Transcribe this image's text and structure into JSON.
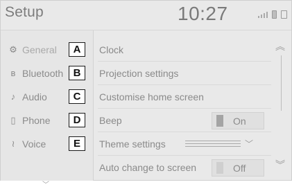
{
  "header": {
    "title": "Setup",
    "time": "10:27",
    "status_icons": [
      "signal-icon",
      "battery-icon",
      "phone-status-icon"
    ]
  },
  "sidebar": {
    "items": [
      {
        "label": "General",
        "icon": "gear-icon",
        "letter": "A",
        "active": true
      },
      {
        "label": "Bluetooth",
        "icon": "bluetooth-icon",
        "letter": "B"
      },
      {
        "label": "Audio",
        "icon": "music-note-icon",
        "letter": "C"
      },
      {
        "label": "Phone",
        "icon": "phone-icon",
        "letter": "D"
      },
      {
        "label": "Voice",
        "icon": "voice-icon",
        "letter": "E"
      }
    ],
    "more_icon": "chevron-down-icon"
  },
  "main": {
    "rows": [
      {
        "label": "Clock"
      },
      {
        "label": "Projection settings"
      },
      {
        "label": "Customise home screen"
      },
      {
        "label": "Beep",
        "toggle": "On"
      },
      {
        "label": "Theme settings",
        "control": "dropdown"
      },
      {
        "label": "Auto change to screen",
        "toggle": "Off"
      }
    ]
  },
  "scrollbar": {
    "up_icon": "chevron-up-double-icon",
    "down_icon": "chevron-down-double-icon"
  }
}
